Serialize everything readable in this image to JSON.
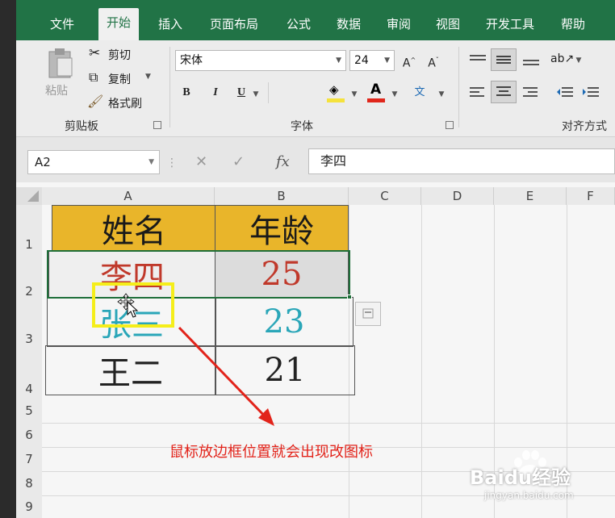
{
  "tabs": [
    {
      "label": "文件",
      "active": false
    },
    {
      "label": "开始",
      "active": true
    },
    {
      "label": "插入",
      "active": false
    },
    {
      "label": "页面布局",
      "active": false
    },
    {
      "label": "公式",
      "active": false
    },
    {
      "label": "数据",
      "active": false
    },
    {
      "label": "审阅",
      "active": false
    },
    {
      "label": "视图",
      "active": false
    },
    {
      "label": "开发工具",
      "active": false
    },
    {
      "label": "帮助",
      "active": false
    }
  ],
  "clipboard": {
    "paste_label": "粘贴",
    "cut_label": "剪切",
    "copy_label": "复制",
    "format_painter_label": "格式刷",
    "group_label": "剪贴板"
  },
  "font": {
    "family": "宋体",
    "size": "24",
    "bold": "B",
    "italic": "I",
    "underline": "U",
    "group_label": "字体"
  },
  "alignment": {
    "group_label": "对齐方式"
  },
  "formula_bar": {
    "name_box": "A2",
    "fx_label": "fx",
    "content": "李四"
  },
  "sheet": {
    "columns": [
      "A",
      "B",
      "C",
      "D",
      "E",
      "F"
    ],
    "rows": [
      "1",
      "2",
      "3",
      "4",
      "5",
      "6",
      "7",
      "8",
      "9"
    ],
    "cells": [
      {
        "name": "姓名",
        "age": "年龄"
      },
      {
        "name": "李四",
        "age": "25"
      },
      {
        "name": "张三",
        "age": "23"
      },
      {
        "name": "王二",
        "age": "21"
      }
    ]
  },
  "colors": {
    "header_fill": "#e9b52a",
    "row2_text": "#c0392b",
    "row3_text": "#2aa6b8",
    "row4_text": "#222222",
    "ribbon_green": "#217346",
    "annotation": "#e2231a",
    "highlight": "#f5ee1a"
  },
  "annotation_text": "鼠标放边框位置就会出现改图标",
  "watermark": {
    "brand": "Baidu经验",
    "url": "jingyan.baidu.com"
  }
}
